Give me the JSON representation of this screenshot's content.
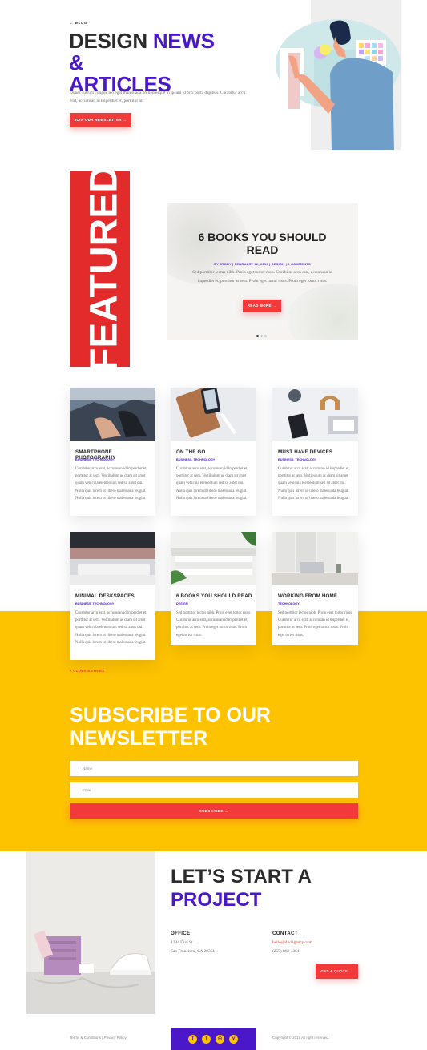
{
  "hero": {
    "eyebrow": "← BLOG",
    "title_part1": "DESIGN ",
    "title_accent": "NEWS &",
    "title_part2": "ARTICLES",
    "description": "Donec rutrum congue leo eget malesuada. Pellentesque in ipsum id orci porta dapibus. Curabitur arcu erat, accumsan id imperdiet et, porttitor at",
    "button_label": "JOIN OUR NEWSLETTER →"
  },
  "featured": {
    "band_label": "FEATURED",
    "title": "6 BOOKS YOU SHOULD READ",
    "meta": "BY STORY | FEBRUARY 12, 2019 | DESIGN | 0 COMMENTS",
    "excerpt": "Sed porttitor lectus nibh. Proin eget tortor risus. Curabitur arcu erat, accumsan id imperdiet et, porttitor at sem. Proin eget tortor risus. Proin eget tortor risus.",
    "button_label": "READ MORE →",
    "slides": 3,
    "active_slide": 1
  },
  "posts": [
    {
      "title": "SMARTPHONE PHOTOGRAPHY",
      "category": "BUSINESS, TECHNOLOGY",
      "excerpt": "Curabitur arcu erat, accumsan id imperdiet et, porttitor at sem. Vestibulum ac diam sit amet quam vehicula elementum sed sit amet dui. Nulla quis lorem ut libero malesuada feugiat. Nulla quis lorem ut libero malesuada feugiat."
    },
    {
      "title": "ON THE GO",
      "category": "BUSINESS, TECHNOLOGY",
      "excerpt": "Curabitur arcu erat, accumsan id imperdiet et, porttitor at sem. Vestibulum ac diam sit amet quam vehicula elementum sed sit amet dui. Nulla quis lorem ut libero malesuada feugiat. Nulla quis lorem ut libero malesuada feugiat."
    },
    {
      "title": "MUST HAVE DEVICES",
      "category": "BUSINESS, TECHNOLOGY",
      "excerpt": "Curabitur arcu erat, accumsan id imperdiet et, porttitor at sem. Vestibulum ac diam sit amet quam vehicula elementum sed sit amet dui. Nulla quis lorem ut libero malesuada feugiat. Nulla quis lorem ut libero malesuada feugiat."
    },
    {
      "title": "MINIMAL DESKSPACES",
      "category": "BUSINESS, TECHNOLOGY",
      "excerpt": "Curabitur arcu erat, accumsan id imperdiet et, porttitor at sem. Vestibulum ac diam sit amet quam vehicula elementum sed sit amet dui. Nulla quis lorem ut libero malesuada feugiat. Nulla quis lorem ut libero malesuada feugiat."
    },
    {
      "title": "6 BOOKS YOU SHOULD READ",
      "category": "DESIGN",
      "excerpt": "Sed porttitor lectus nibh. Proin eget tortor risus. Curabitur arcu erat, accumsan id imperdiet et, porttitor at sem. Proin eget tortor risus. Proin eget tortor risus."
    },
    {
      "title": "WORKING FROM HOME",
      "category": "TECHNOLOGY",
      "excerpt": "Sed porttitor lectus nibh. Proin eget tortor risus. Curabitur arcu erat, accumsan id imperdiet et, porttitor at sem. Proin eget tortor risus. Proin eget tortor risus."
    }
  ],
  "older_entries": "« OLDER ENTRIES",
  "subscribe": {
    "title_line1": "SUBSCRIBE TO OUR",
    "title_line2": "NEWSLETTER",
    "name_placeholder": "Name",
    "email_placeholder": "Email",
    "button_label": "SUBSCRIBE →"
  },
  "contact": {
    "title_line1": "LET’S START A",
    "title_accent": "PROJECT",
    "office_label": "OFFICE",
    "office_line1": "1234 Divi St.",
    "office_line2": "San Francisco, CA 29351",
    "contact_label": "CONTACT",
    "email": "hello@diviagency.com",
    "phone": "(255) 862-1351",
    "quote_button": "GET A QUOTE →"
  },
  "footer": {
    "links": "Terms & Conditions | Privacy Policy",
    "copyright": "Copyright © 2019 All right reserved.",
    "social": [
      {
        "icon": "facebook-icon",
        "glyph": "f"
      },
      {
        "icon": "twitter-icon",
        "glyph": "t"
      },
      {
        "icon": "instagram-icon",
        "glyph": "◎"
      },
      {
        "icon": "vimeo-icon",
        "glyph": "v"
      }
    ]
  },
  "colors": {
    "accent_purple": "#4a17c9",
    "accent_red": "#f23a3a",
    "yellow": "#fdc200"
  }
}
